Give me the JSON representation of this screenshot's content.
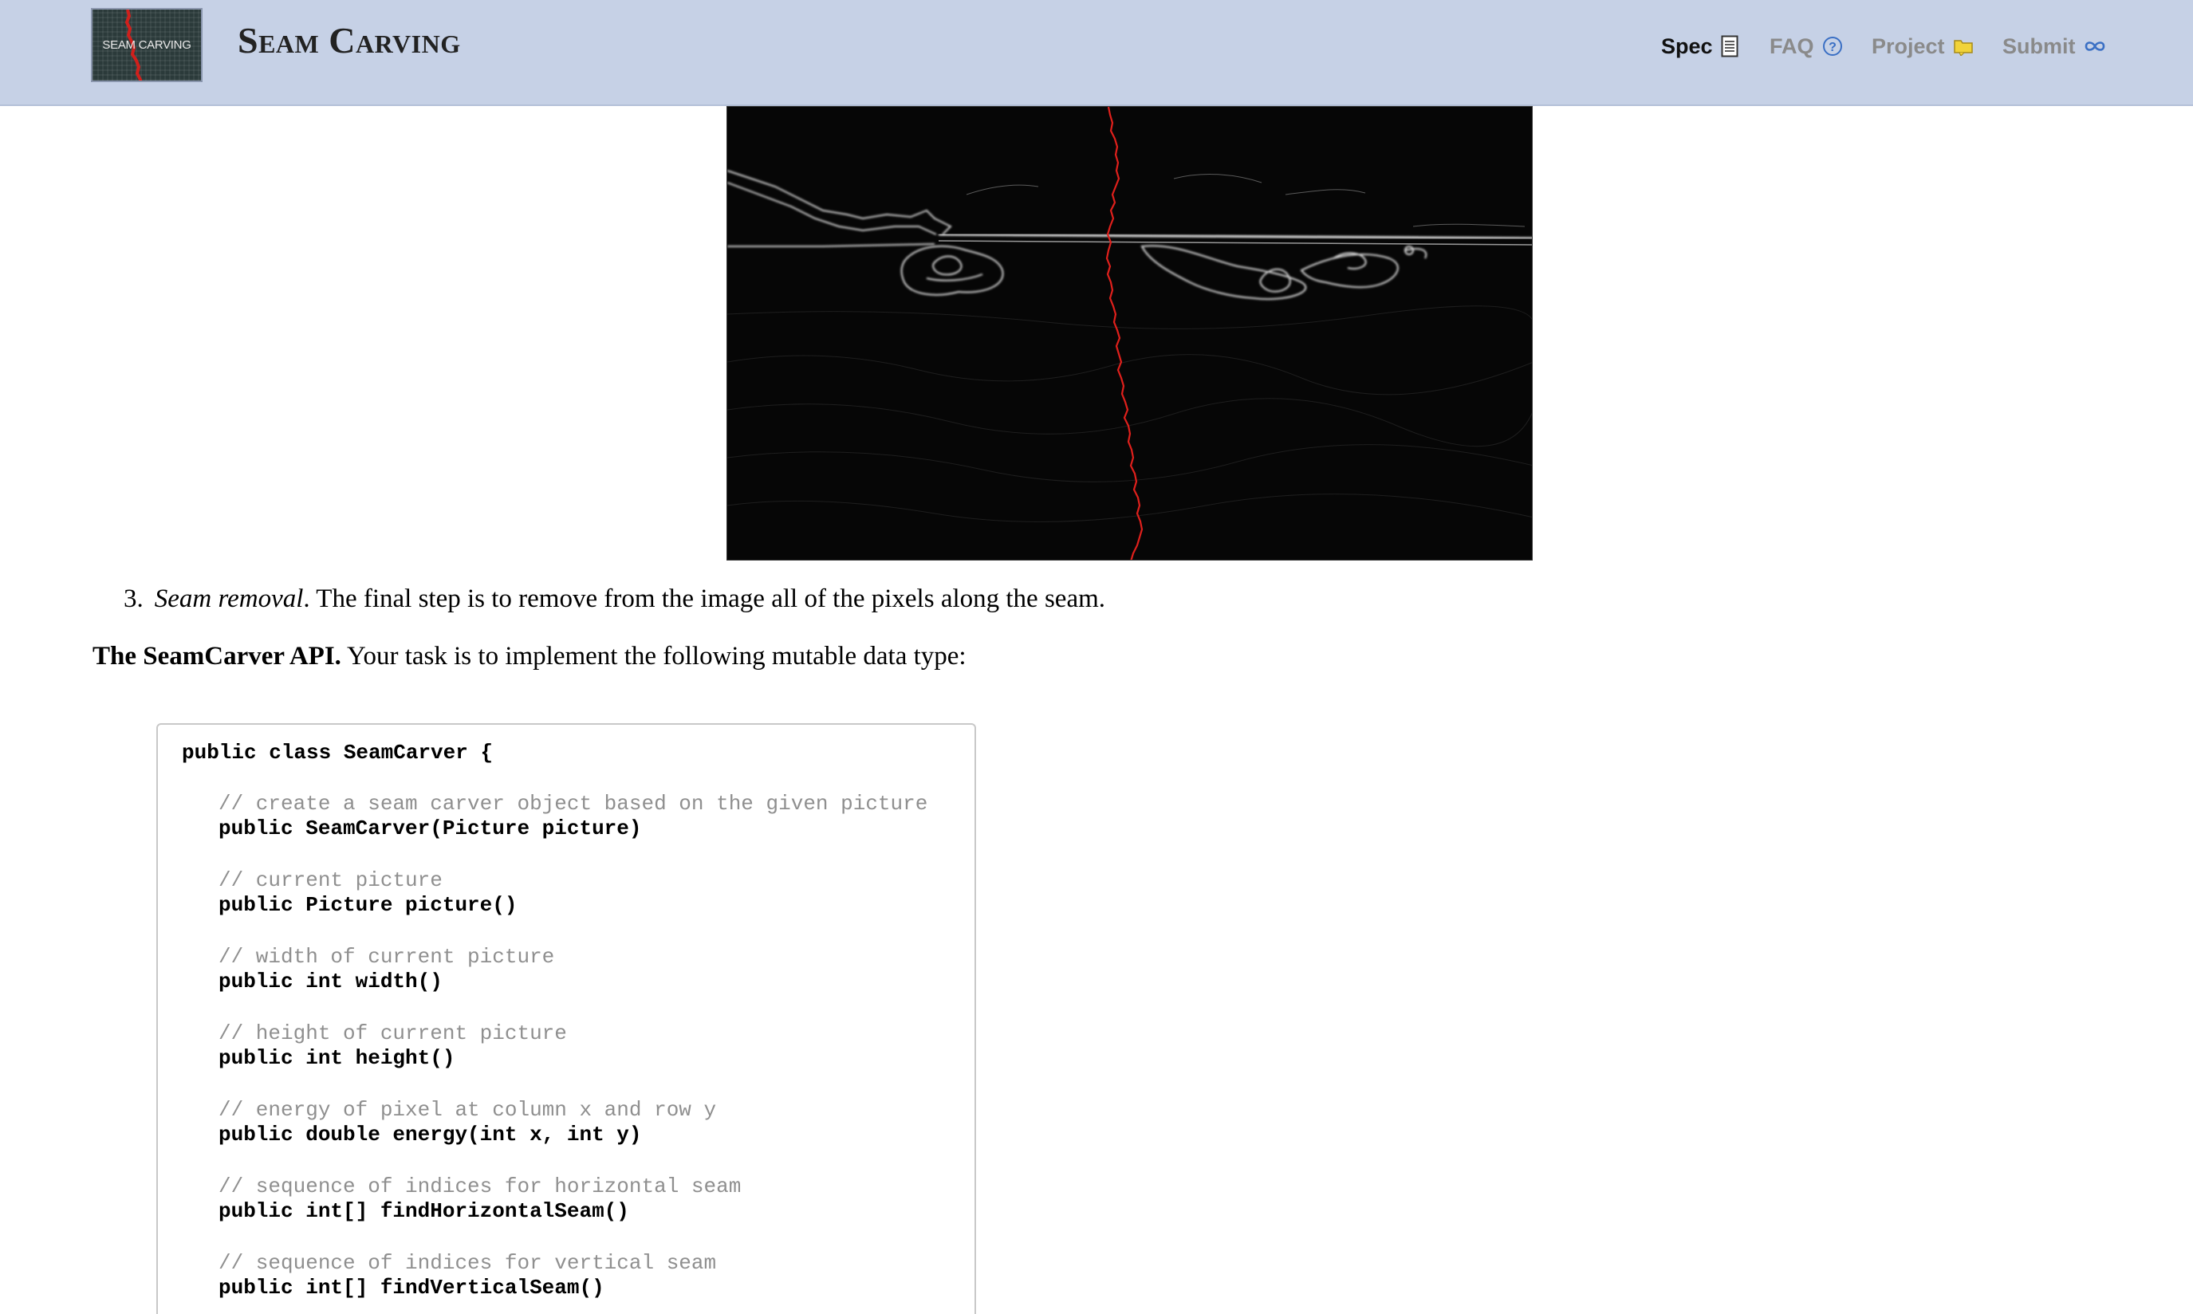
{
  "header": {
    "logo_text": "SEAM CARVING",
    "title": "Seam Carving",
    "nav": [
      {
        "label": "Spec",
        "icon": "document-icon",
        "active": true
      },
      {
        "label": "FAQ",
        "icon": "question-circle-icon",
        "active": false
      },
      {
        "label": "Project",
        "icon": "folder-icon",
        "active": false
      },
      {
        "label": "Submit",
        "icon": "infinity-icon",
        "active": false
      }
    ]
  },
  "colors": {
    "header_bg": "#c6d1e6",
    "nav_inactive": "#8a8a8a",
    "nav_active": "#111111",
    "icon_blue": "#3a6fc4",
    "icon_yellow": "#f1d33a",
    "seam_red": "#e0201c",
    "code_comment": "#8f8f8f"
  },
  "content": {
    "step_number": "3.",
    "step_title": "Seam removal",
    "step_text": ". The final step is to remove from the image all of the pixels along the seam.",
    "api_heading": "The SeamCarver API.",
    "api_text": " Your task is to implement the following mutable data type:"
  },
  "code": {
    "class_line": "public class SeamCarver {",
    "methods": [
      {
        "comment": "// create a seam carver object based on the given picture",
        "signature": "public SeamCarver(Picture picture)"
      },
      {
        "comment": "// current picture",
        "signature": "public Picture picture()"
      },
      {
        "comment": "// width of current picture",
        "signature": "public int width()"
      },
      {
        "comment": "// height of current picture",
        "signature": "public int height()"
      },
      {
        "comment": "// energy of pixel at column x and row y",
        "signature": "public double energy(int x, int y)"
      },
      {
        "comment": "// sequence of indices for horizontal seam",
        "signature": "public int[] findHorizontalSeam()"
      },
      {
        "comment": "// sequence of indices for vertical seam",
        "signature": "public int[] findVerticalSeam()"
      }
    ]
  }
}
